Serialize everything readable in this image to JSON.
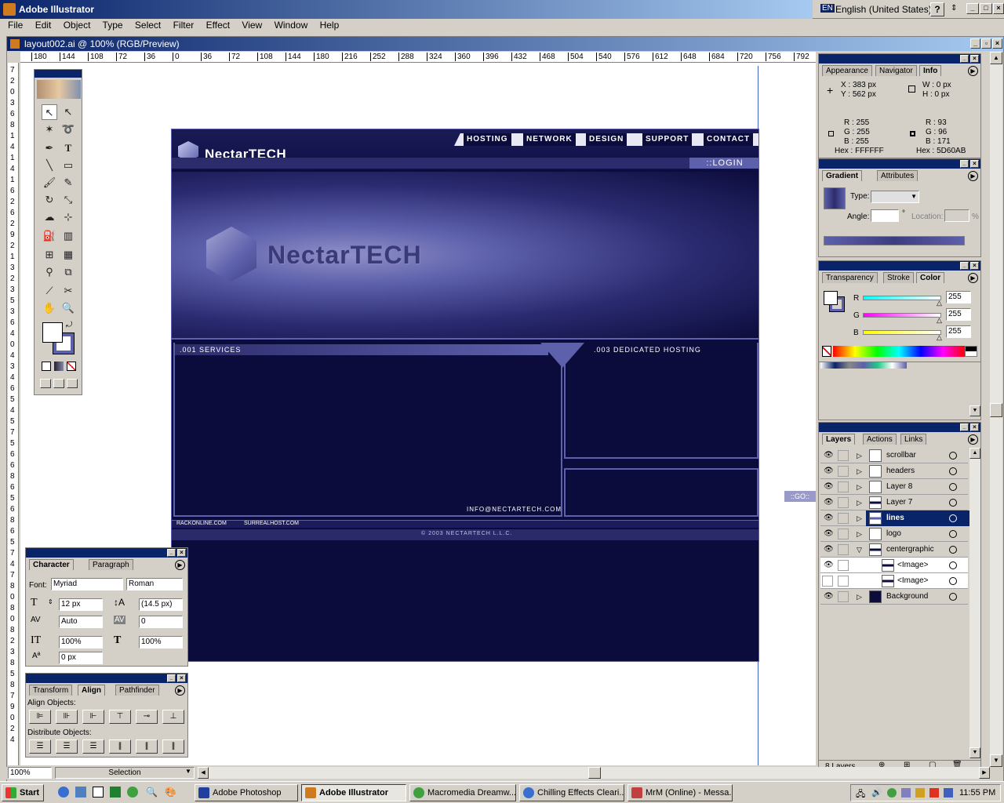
{
  "app": {
    "title": "Adobe Illustrator"
  },
  "lang_bar": {
    "code": "EN",
    "label": "English (United States)",
    "help": "?"
  },
  "menu": [
    "File",
    "Edit",
    "Object",
    "Type",
    "Select",
    "Filter",
    "Effect",
    "View",
    "Window",
    "Help"
  ],
  "doc": {
    "title": "layout002.ai @ 100% (RGB/Preview)"
  },
  "ruler": {
    "h_ticks": [
      "180",
      "144",
      "108",
      "72",
      "36",
      "0",
      "36",
      "72",
      "108",
      "144",
      "180",
      "216",
      "252",
      "288",
      "324",
      "360",
      "396",
      "432",
      "468",
      "504",
      "540",
      "576",
      "612",
      "648",
      "684",
      "720",
      "756",
      "792"
    ],
    "v_ticks": [
      "7",
      "2",
      "0",
      "3",
      "6",
      "8",
      "1",
      "4",
      "1",
      "4",
      "1",
      "6",
      "2",
      "6",
      "2",
      "9",
      "2",
      "1",
      "3",
      "2",
      "3",
      "5",
      "3",
      "6",
      "4",
      "0",
      "4",
      "3",
      "4",
      "6",
      "5",
      "4",
      "5",
      "7",
      "5",
      "6",
      "6",
      "8",
      "6",
      "5",
      "6",
      "8",
      "6",
      "5",
      "7",
      "4",
      "7",
      "8",
      "0",
      "8",
      "0",
      "8",
      "2",
      "3",
      "8",
      "5",
      "8",
      "7",
      "9",
      "0",
      "2",
      "4"
    ]
  },
  "site": {
    "logo": "NectarTECH",
    "nav": [
      "HOSTING",
      "NETWORK",
      "DESIGN",
      "SUPPORT",
      "CONTACT"
    ],
    "login": "::LOGIN",
    "banner_logo": "NectarTECH",
    "services": ".001 SERVICES",
    "dedicated": ".003 DEDICATED HOSTING",
    "email": "INFO@NECTARTECH.COM",
    "link1": "RACKONLINE.COM",
    "link2": "SURREALHOST.COM",
    "copyright": "© 2003 NECTARTECH L.L.C.",
    "go": "::GO::"
  },
  "info_panel": {
    "tabs": [
      "Appearance",
      "Navigator",
      "Info"
    ],
    "x": "X : 383 px",
    "y": "Y : 562 px",
    "w": "W : 0 px",
    "h": "H : 0 px",
    "r1": "R : 255",
    "g1": "G : 255",
    "b1": "B : 255",
    "hex1": "Hex : FFFFFF",
    "r2": "R : 93",
    "g2": "G : 96",
    "b2": "B : 171",
    "hex2": "Hex : 5D60AB"
  },
  "gradient_panel": {
    "tabs": [
      "Gradient",
      "Attributes"
    ],
    "type_label": "Type:",
    "angle_label": "Angle:",
    "location_label": "Location:",
    "deg": "°",
    "pct": "%"
  },
  "color_panel": {
    "tabs": [
      "Transparency",
      "Stroke",
      "Color"
    ],
    "r_label": "R",
    "g_label": "G",
    "b_label": "B",
    "r": "255",
    "g": "255",
    "b": "255"
  },
  "layers_panel": {
    "tabs": [
      "Layers",
      "Actions",
      "Links"
    ],
    "layers": [
      "scrollbar",
      "headers",
      "Layer 8",
      "Layer 7",
      "lines",
      "logo",
      "centergraphic",
      "<Image>",
      "<Image>",
      "Background"
    ],
    "count": "8 Layers"
  },
  "character_panel": {
    "tabs": [
      "Character",
      "Paragraph"
    ],
    "font_label": "Font:",
    "font": "Myriad",
    "style": "Roman",
    "size": "12 px",
    "leading": "(14.5 px)",
    "kerning": "Auto",
    "tracking": "0",
    "vscale": "100%",
    "hscale": "100%",
    "baseline": "0 px"
  },
  "align_panel": {
    "tabs": [
      "Transform",
      "Align",
      "Pathfinder"
    ],
    "align_label": "Align Objects:",
    "dist_label": "Distribute Objects:"
  },
  "status": {
    "zoom": "100%",
    "tool": "Selection"
  },
  "taskbar": {
    "start": "Start",
    "tasks": [
      "Adobe Photoshop",
      "Adobe Illustrator",
      "Macromedia Dreamw...",
      "Chilling Effects Cleari...",
      "MrM (Online) - Messa..."
    ],
    "clock": "11:55 PM"
  },
  "colors": {
    "site_bg": "#0c0c3c",
    "site_accent": "#5d60ab",
    "titlebar": "#0a246a"
  }
}
